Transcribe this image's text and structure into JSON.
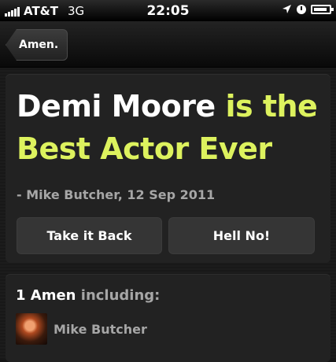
{
  "status_bar": {
    "carrier": "AT&T",
    "network": "3G",
    "time": "22:05",
    "icons": [
      "signal-bars-icon",
      "location-arrow-icon",
      "clock-icon",
      "battery-charging-icon"
    ],
    "battery_level": 0.9
  },
  "nav": {
    "back_label": "Amen."
  },
  "statement": {
    "subject": "Demi Moore",
    "verb": "is the",
    "object": "Best Actor Ever",
    "author_line": "- Mike Butcher, 12 Sep 2011",
    "buttons": {
      "take_back": "Take it Back",
      "hell_no": "Hell No!"
    }
  },
  "amens": {
    "count_label": "1 Amen",
    "suffix": "including:",
    "users": [
      {
        "name": "Mike Butcher"
      }
    ]
  },
  "colors": {
    "accent": "#ddf25e",
    "muted_text": "#a6a6a6",
    "card": "#222222"
  }
}
